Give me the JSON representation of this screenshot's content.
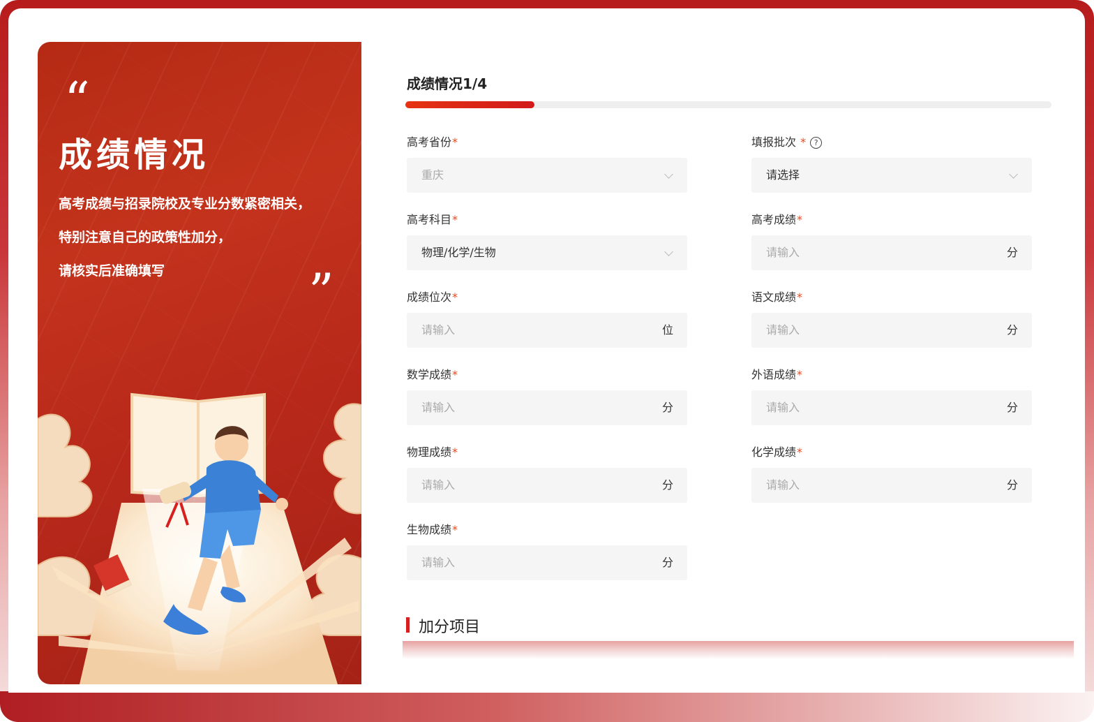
{
  "hero": {
    "open_quote": "“",
    "close_quote": "”",
    "title": "成绩情况",
    "lines": [
      "高考成绩与招录院校及专业分数紧密相关，",
      "特别注意自己的政策性加分，",
      "请核实后准确填写"
    ]
  },
  "form": {
    "step_title": "成绩情况1/4",
    "progress": 0.2,
    "required_mark": "*",
    "fields": [
      {
        "label": "高考省份",
        "value": "重庆",
        "type": "select",
        "placeholder": false
      },
      {
        "label": "填报批次",
        "value": "请选择",
        "type": "select",
        "placeholder": false,
        "help": "?"
      },
      {
        "label": "高考科目",
        "value": "物理/化学/生物",
        "type": "select",
        "placeholder": false
      },
      {
        "label": "高考成绩",
        "value": "请输入",
        "unit": "分",
        "type": "input",
        "placeholder": true
      },
      {
        "label": "成绩位次",
        "value": "请输入",
        "unit": "位",
        "type": "input",
        "placeholder": true
      },
      {
        "label": "语文成绩",
        "value": "请输入",
        "unit": "分",
        "type": "input",
        "placeholder": true
      },
      {
        "label": "数学成绩",
        "value": "请输入",
        "unit": "分",
        "type": "input",
        "placeholder": true
      },
      {
        "label": "外语成绩",
        "value": "请输入",
        "unit": "分",
        "type": "input",
        "placeholder": true
      },
      {
        "label": "物理成绩",
        "value": "请输入",
        "unit": "分",
        "type": "input",
        "placeholder": true
      },
      {
        "label": "化学成绩",
        "value": "请输入",
        "unit": "分",
        "type": "input",
        "placeholder": true
      },
      {
        "label": "生物成绩",
        "value": "请输入",
        "unit": "分",
        "type": "input",
        "placeholder": true
      }
    ],
    "section_title": "加分项目"
  },
  "colors": {
    "brand": "#c3331c",
    "accent": "#e63312",
    "required": "#e8491d"
  }
}
